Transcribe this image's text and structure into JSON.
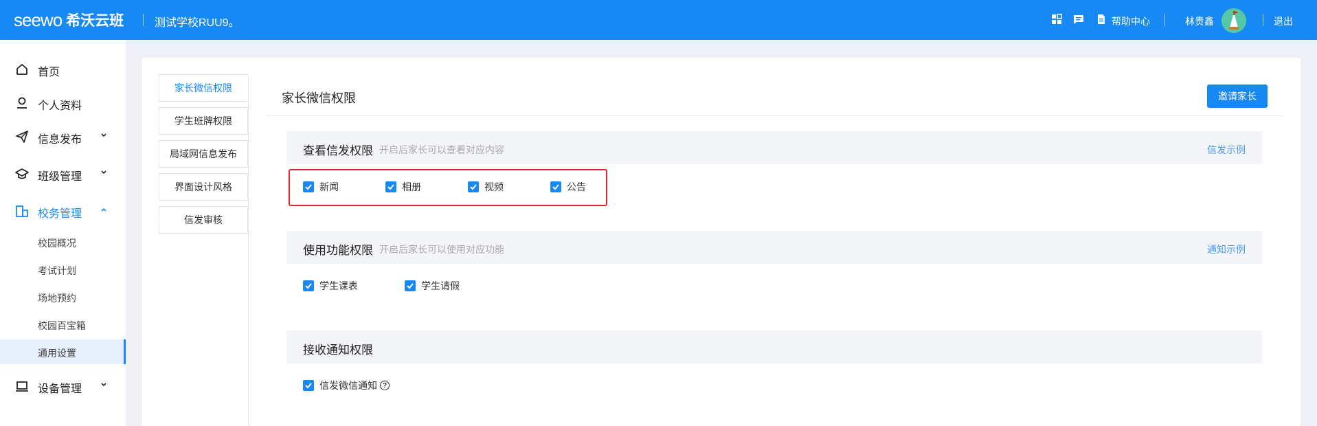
{
  "header": {
    "logo_en": "seewo",
    "logo_cn": "希沃云班",
    "school_name": "测试学校RUU9。",
    "help_label": "帮助中心",
    "user_name": "林贵鑫",
    "logout_label": "退出"
  },
  "sidebar": {
    "items": [
      {
        "label": "首页",
        "icon": "home-icon"
      },
      {
        "label": "个人资料",
        "icon": "user-icon"
      },
      {
        "label": "信息发布",
        "icon": "send-icon"
      },
      {
        "label": "班级管理",
        "icon": "graduation-cap-icon"
      },
      {
        "label": "校务管理",
        "icon": "school-affairs-icon"
      },
      {
        "label": "设备管理",
        "icon": "laptop-icon"
      }
    ],
    "subitems": [
      "校园概况",
      "考试计划",
      "场地预约",
      "校园百宝箱",
      "通用设置"
    ],
    "active_item": "校务管理",
    "selected_subitem": "通用设置"
  },
  "tabs": [
    "家长微信权限",
    "学生班牌权限",
    "局域网信息发布",
    "界面设计风格",
    "信发审核"
  ],
  "active_tab": "家长微信权限",
  "content": {
    "title": "家长微信权限",
    "invite_button": "邀请家长",
    "sections": [
      {
        "title": "查看信发权限",
        "desc": "开启后家长可以查看对应内容",
        "link": "信发示例",
        "options": [
          "新闻",
          "相册",
          "视频",
          "公告"
        ]
      },
      {
        "title": "使用功能权限",
        "desc": "开启后家长可以使用对应功能",
        "link": "通知示例",
        "options": [
          "学生课表",
          "学生请假"
        ]
      },
      {
        "title": "接收通知权限",
        "options": [
          "信发微信通知"
        ]
      }
    ],
    "help_mark": "?"
  },
  "colors": {
    "primary": "#1789f5",
    "highlight": "#e0242c",
    "section_bg": "#f4f5f8",
    "page_bg": "#eef0f5"
  }
}
